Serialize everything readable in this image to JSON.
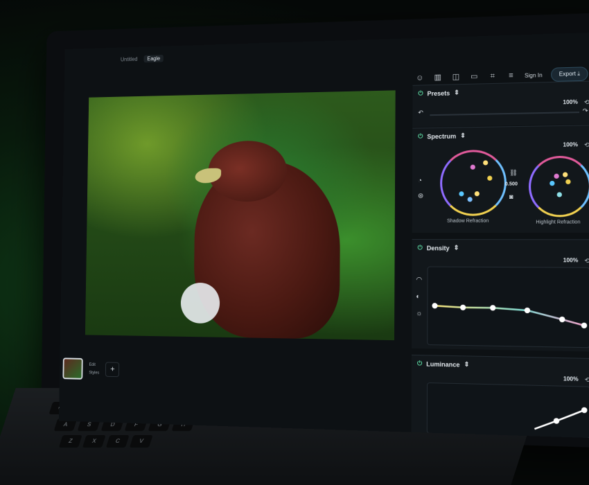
{
  "window": {
    "tabs": [
      "Untitled",
      "Eagle"
    ]
  },
  "toolbar": {
    "sign_in": "Sign In",
    "export": "Export",
    "icons": [
      "smiley-icon",
      "columns-icon",
      "compare-icon",
      "monitor-icon",
      "crop-icon",
      "menu-icon",
      "download-icon"
    ]
  },
  "filmstrip": {
    "item_label_1": "Edit",
    "item_label_2": "Styles",
    "add": "+"
  },
  "presets": {
    "title": "Presets",
    "percent": "100%"
  },
  "spectrum": {
    "title": "Spectrum",
    "percent": "100%",
    "link_value": "0.500",
    "shadow_label": "Shadow Refraction",
    "highlight_label": "Highlight Refraction"
  },
  "density": {
    "title": "Density",
    "percent": "100%"
  },
  "luminance": {
    "title": "Luminance",
    "percent": "100%"
  },
  "colors": {
    "accent": "#5bd6a0",
    "background": "#12171b"
  }
}
